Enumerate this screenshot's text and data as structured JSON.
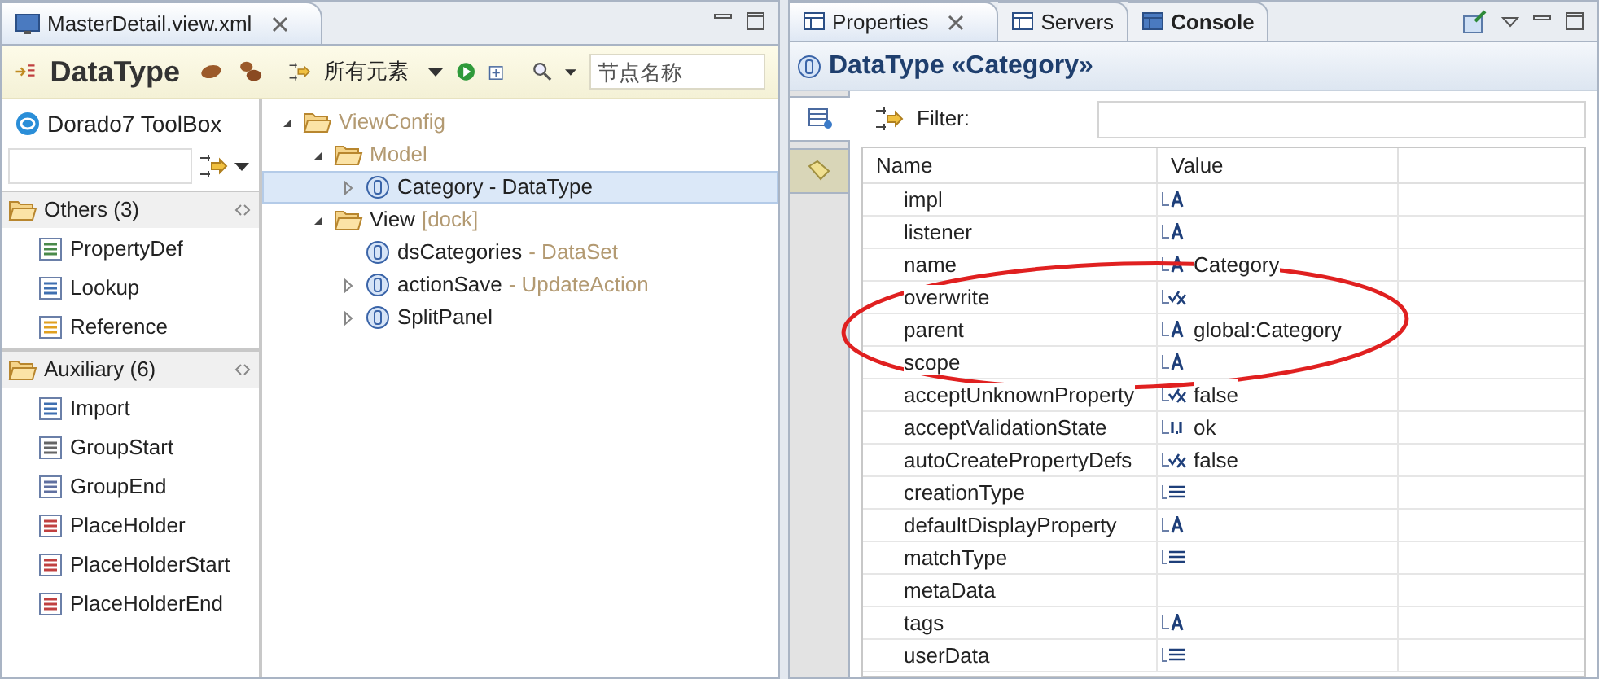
{
  "editor": {
    "tab_title": "MasterDetail.view.xml",
    "toolbar": {
      "title": "DataType",
      "filter_label": "所有元素",
      "search_placeholder": "节点名称"
    },
    "toolbox": {
      "title": "Dorado7 ToolBox",
      "groups": [
        {
          "label": "Others (3)",
          "expanded": true,
          "items": [
            "PropertyDef",
            "Lookup",
            "Reference"
          ]
        },
        {
          "label": "Auxiliary (6)",
          "expanded": true,
          "items": [
            "Import",
            "GroupStart",
            "GroupEnd",
            "PlaceHolder",
            "PlaceHolderStart",
            "PlaceHolderEnd"
          ]
        }
      ]
    },
    "tree": [
      {
        "label": "ViewConfig",
        "muted": true,
        "has_children": true,
        "expanded": true,
        "selected": false,
        "children": [
          {
            "label": "Model",
            "muted": true,
            "has_children": true,
            "expanded": true,
            "selected": false,
            "children": [
              {
                "label": "Category - DataType",
                "muted": false,
                "has_children": true,
                "expanded": false,
                "selected": true
              }
            ]
          },
          {
            "label": "View",
            "suffix": "[dock]",
            "muted": false,
            "has_children": true,
            "expanded": true,
            "selected": false,
            "children": [
              {
                "label": "dsCategories",
                "suffix": "- DataSet",
                "muted": false,
                "has_children": false,
                "expanded": false,
                "selected": false
              },
              {
                "label": "actionSave",
                "suffix": "- UpdateAction",
                "muted": false,
                "has_children": true,
                "expanded": false,
                "selected": false
              },
              {
                "label": "SplitPanel",
                "muted": false,
                "has_children": true,
                "expanded": false,
                "selected": false
              }
            ]
          }
        ]
      }
    ]
  },
  "properties_view": {
    "tabs": [
      {
        "label": "Properties",
        "selected": true,
        "closable": true,
        "bold": false
      },
      {
        "label": "Servers",
        "selected": false,
        "closable": false,
        "bold": false
      },
      {
        "label": "Console",
        "selected": false,
        "closable": false,
        "bold": true
      }
    ],
    "title": "DataType «Category»",
    "side_tabs": [
      {
        "selected": true
      },
      {
        "selected": false
      }
    ],
    "filter_label": "Filter:",
    "columns": [
      "Name",
      "Value"
    ],
    "rows": [
      {
        "name": "impl",
        "kind": "text"
      },
      {
        "name": "listener",
        "kind": "text"
      },
      {
        "name": "name",
        "kind": "text",
        "value": "Category"
      },
      {
        "name": "overwrite",
        "kind": "boolean"
      },
      {
        "name": "parent",
        "kind": "text",
        "value": "global:Category"
      },
      {
        "name": "scope",
        "kind": "text"
      },
      {
        "name": "acceptUnknownProperty",
        "kind": "boolean",
        "value": "false"
      },
      {
        "name": "acceptValidationState",
        "kind": "number",
        "value": "ok"
      },
      {
        "name": "autoCreatePropertyDefs",
        "kind": "boolean",
        "value": "false"
      },
      {
        "name": "creationType",
        "kind": "list"
      },
      {
        "name": "defaultDisplayProperty",
        "kind": "text"
      },
      {
        "name": "matchType",
        "kind": "list"
      },
      {
        "name": "metaData",
        "kind": "none"
      },
      {
        "name": "tags",
        "kind": "text"
      },
      {
        "name": "userData",
        "kind": "list"
      }
    ]
  }
}
